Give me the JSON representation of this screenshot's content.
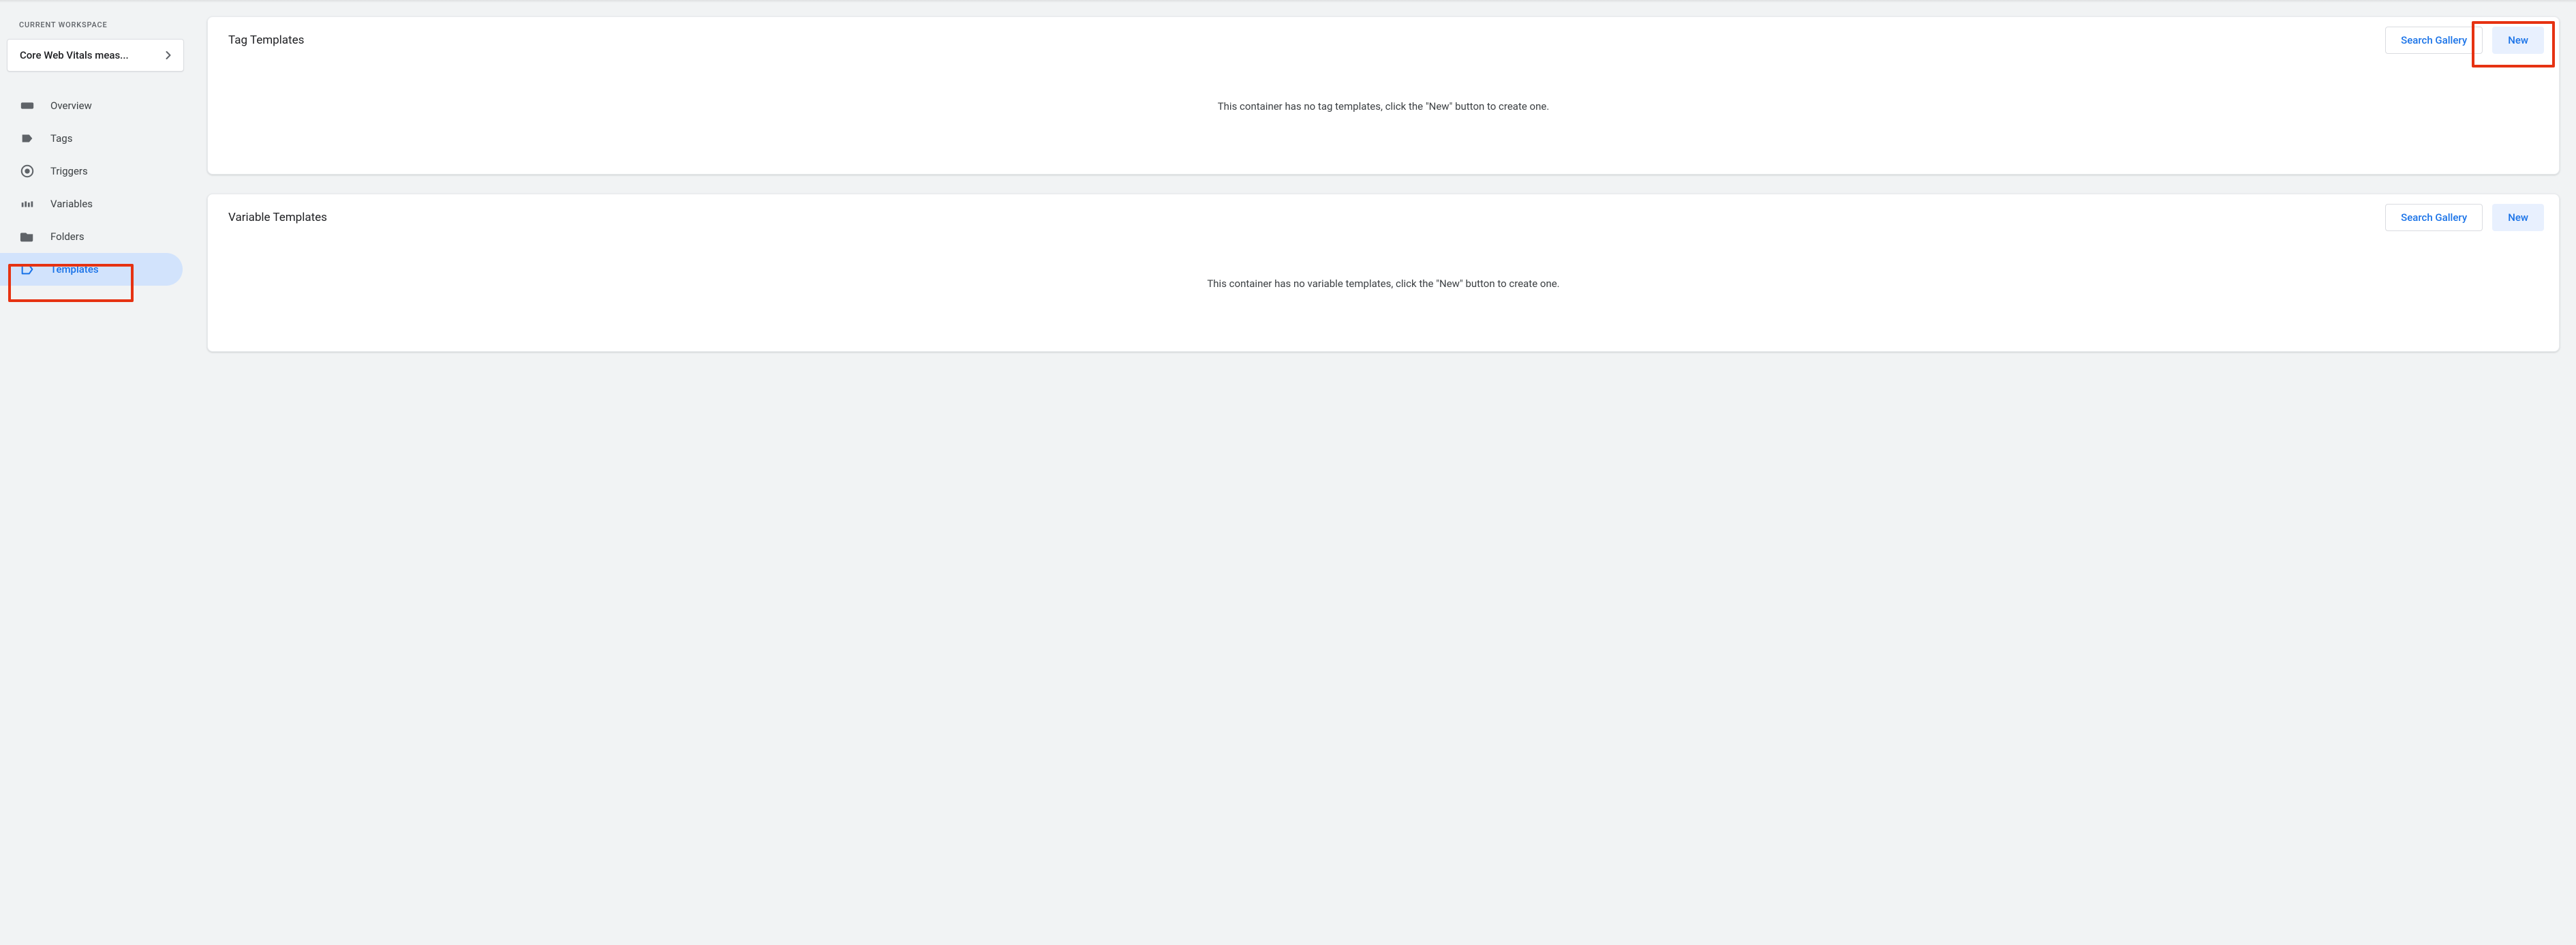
{
  "sidebar": {
    "workspace_label": "CURRENT WORKSPACE",
    "workspace_name": "Core Web Vitals meas...",
    "items": [
      {
        "label": "Overview",
        "icon": "overview",
        "active": false
      },
      {
        "label": "Tags",
        "icon": "tag",
        "active": false
      },
      {
        "label": "Triggers",
        "icon": "trigger",
        "active": false
      },
      {
        "label": "Variables",
        "icon": "variable",
        "active": false
      },
      {
        "label": "Folders",
        "icon": "folder",
        "active": false
      },
      {
        "label": "Templates",
        "icon": "template",
        "active": true
      }
    ]
  },
  "cards": {
    "tag": {
      "title": "Tag Templates",
      "search_label": "Search Gallery",
      "new_label": "New",
      "empty_text": "This container has no tag templates, click the \"New\" button to create one."
    },
    "variable": {
      "title": "Variable Templates",
      "search_label": "Search Gallery",
      "new_label": "New",
      "empty_text": "This container has no variable templates, click the \"New\" button to create one."
    }
  }
}
